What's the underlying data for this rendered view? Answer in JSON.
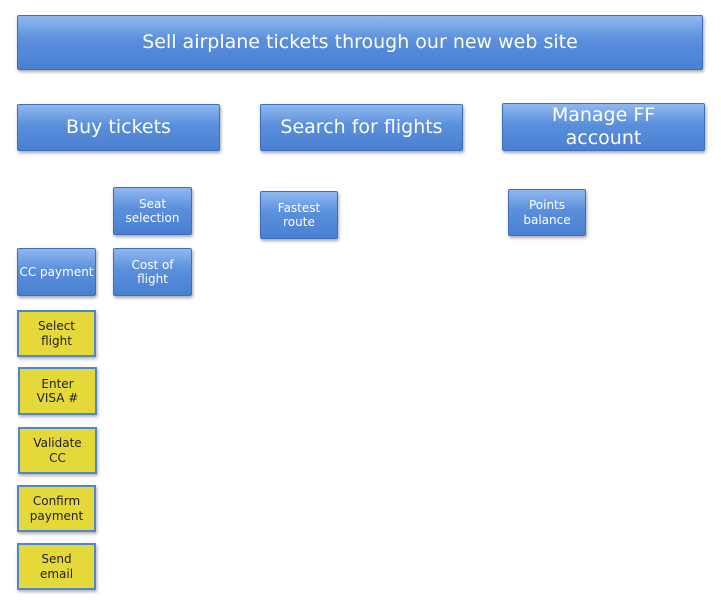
{
  "title": "Sell airplane tickets through our new web site",
  "activities": [
    {
      "label": "Buy tickets"
    },
    {
      "label": "Search for flights"
    },
    {
      "label": "Manage FF account"
    }
  ],
  "stories": {
    "seat_selection": "Seat selection",
    "cost_of_flight": "Cost of flight",
    "cc_payment": "CC payment",
    "fastest_route": "Fastest route",
    "points_balance": "Points balance"
  },
  "tasks": [
    "Select flight",
    "Enter VISA #",
    "Validate CC",
    "Confirm payment",
    "Send email"
  ],
  "colors": {
    "story": "#5a8fdc",
    "task": "#e5d93a",
    "task_border": "#4f86cf"
  }
}
